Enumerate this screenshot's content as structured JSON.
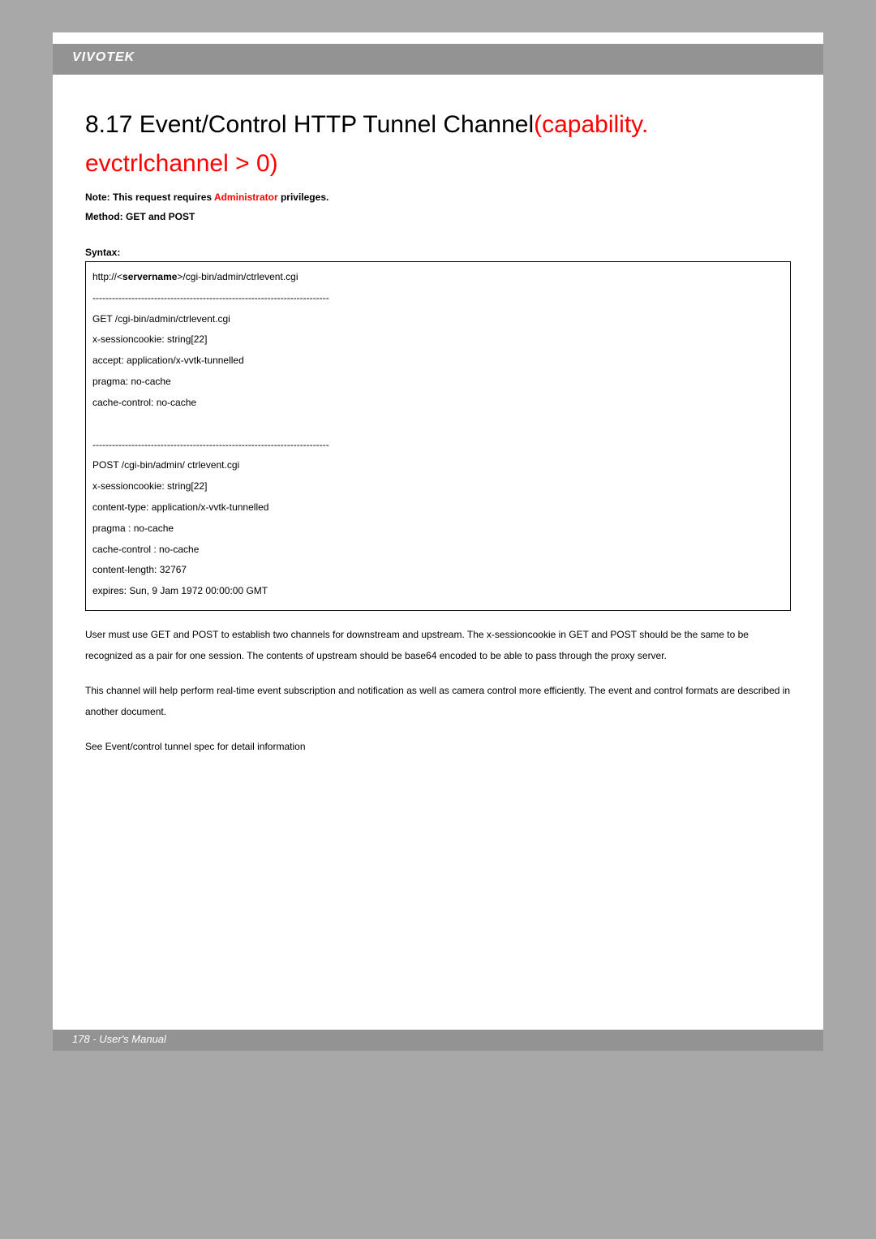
{
  "header": {
    "brand": "VIVOTEK"
  },
  "title": {
    "num": "8.17 ",
    "main": "Event/Control HTTP Tunnel Channel",
    "cond": "(capability. evctrlchannel > 0)"
  },
  "note": {
    "label": "Note:",
    "before": " This request requires ",
    "red": "Administrator",
    "after": " privileges."
  },
  "method": {
    "label": "Method: ",
    "value": "GET and POST"
  },
  "syntax_label": "Syntax:",
  "code": {
    "l1a": "http://<",
    "l1b": "servername",
    "l1c": ">/cgi-bin/admin/ctrlevent.cgi",
    "l2": "-------------------------------------------------------------------------",
    "l3": "GET /cgi-bin/admin/ctrlevent.cgi",
    "l4": "x-sessioncookie: string[22]",
    "l5": "accept: application/x-vvtk-tunnelled",
    "l6": "pragma: no-cache",
    "l7": "cache-control: no-cache",
    "l8": "-------------------------------------------------------------------------",
    "l9": "POST /cgi-bin/admin/ ctrlevent.cgi",
    "l10": "x-sessioncookie: string[22]",
    "l11": "content-type: application/x-vvtk-tunnelled",
    "l12": "pragma : no-cache",
    "l13": "cache-control : no-cache",
    "l14": "content-length: 32767",
    "l15": "expires: Sun, 9 Jam 1972 00:00:00 GMT"
  },
  "after": {
    "p1": "User must use GET and POST to establish two channels for downstream and upstream. The x-sessioncookie in GET and POST should be the same to be recognized as a pair for one session. The contents of upstream should be base64 encoded to be able to pass through the proxy server.",
    "p2": "This channel will help perform real-time event subscription and notification as well as camera control more efficiently. The event and control formats are described in another document.",
    "p3": "See Event/control tunnel spec for detail information"
  },
  "footer": {
    "text": "178 - User's Manual"
  }
}
